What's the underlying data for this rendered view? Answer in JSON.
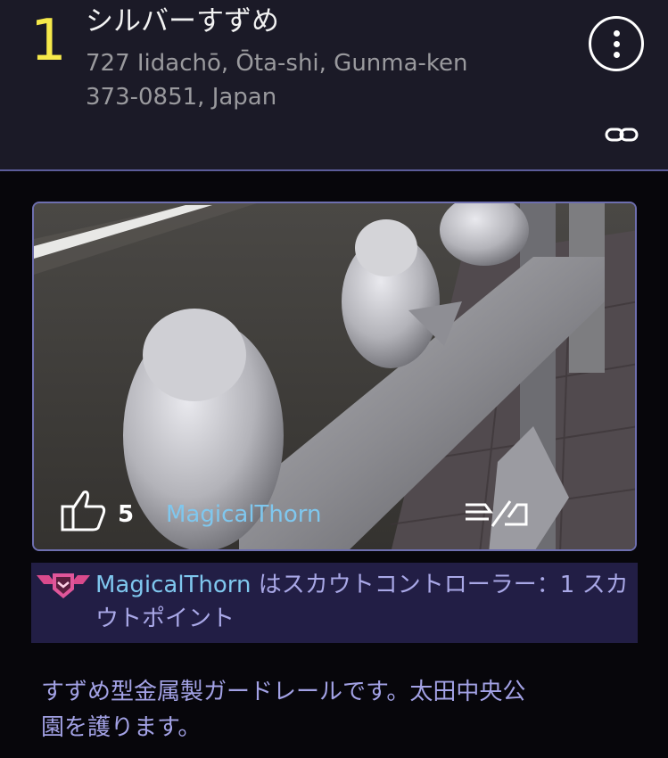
{
  "portal": {
    "rank": "1",
    "title": "シルバーすずめ",
    "address_line1": "727 Iidachō, Ōta-shi, Gunma-ken",
    "address_line2": "373-0851, Japan"
  },
  "icons": {
    "menu": "more-vertical-icon",
    "link": "link-icon",
    "like": "thumbs-up-icon",
    "flag": "flag-report-icon",
    "badge": "scout-controller-badge-icon"
  },
  "photo": {
    "like_count": "5",
    "uploader": "MagicalThorn"
  },
  "scout": {
    "user": "MagicalThorn",
    "text": " はスカウトコントローラー：1 スカウトポイント"
  },
  "description": "すずめ型金属製ガードレールです。太田中央公園を護ります。",
  "colors": {
    "rank": "#f6e94a",
    "username": "#7fc7ee",
    "scout_bg": "#221e45",
    "description": "#a3a2e6",
    "header_bg": "#1b1a27"
  }
}
